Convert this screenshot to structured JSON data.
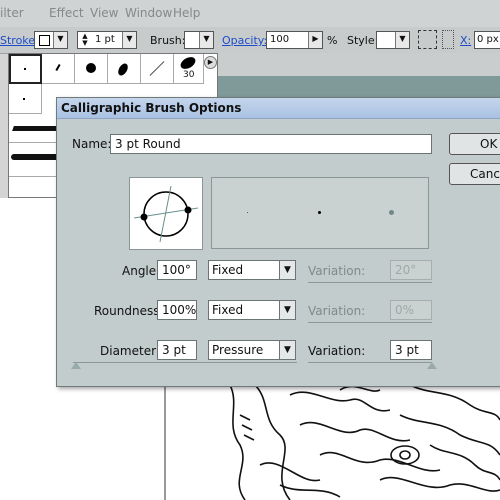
{
  "menubar": {
    "items": [
      "ilter",
      "Effect",
      "View",
      "Window",
      "Help"
    ]
  },
  "controlbar": {
    "stroke_label": "Stroke:",
    "stroke_weight": "1 pt",
    "brush_label": "Brush:",
    "opacity_label": "Opacity:",
    "opacity_value": "100",
    "opacity_unit": "%",
    "style_label": "Style:",
    "x_label": "X:",
    "x_value": "0 px"
  },
  "brush_palette": {
    "size_badge": "30"
  },
  "dialog": {
    "title": "Calligraphic Brush Options",
    "name_label": "Name:",
    "name_value": "3 pt Round",
    "ok_label": "OK",
    "cancel_label": "Cance",
    "rows": [
      {
        "label": "Angle:",
        "value": "100°",
        "mode": "Fixed",
        "variation_label": "Variation:",
        "variation": "20°",
        "variation_enabled": false
      },
      {
        "label": "Roundness:",
        "value": "100%",
        "mode": "Fixed",
        "variation_label": "Variation:",
        "variation": "0%",
        "variation_enabled": false
      },
      {
        "label": "Diameter:",
        "value": "3 pt",
        "mode": "Pressure",
        "variation_label": "Variation:",
        "variation": "3 pt",
        "variation_enabled": true
      }
    ]
  },
  "colors": {
    "dialog_bg": "#c2cccc",
    "titlebar": "#b3c8e6",
    "link_blue": "#1e4cc8"
  }
}
